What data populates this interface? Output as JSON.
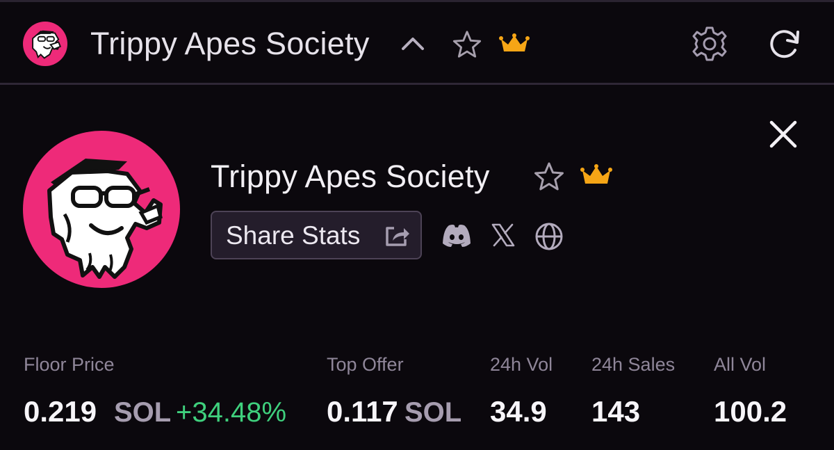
{
  "colors": {
    "background": "#0b080d",
    "accent_pink": "#ee2a79",
    "crown_gold": "#f5a516",
    "positive_green": "#3fd07d",
    "muted_text": "#8f8699"
  },
  "header": {
    "title": "Trippy Apes Society",
    "icons": [
      "collection-avatar",
      "chevron-up-icon",
      "star-icon",
      "crown-icon",
      "gear-icon",
      "refresh-icon"
    ]
  },
  "collection": {
    "name": "Trippy Apes Society",
    "share_label": "Share Stats",
    "icons": [
      "close-icon",
      "star-icon",
      "crown-icon",
      "share-icon",
      "discord-icon",
      "x-icon",
      "globe-icon"
    ]
  },
  "stats": {
    "floor_price": {
      "label": "Floor Price",
      "value": "0.219",
      "unit": "SOL",
      "change": "+34.48%"
    },
    "top_offer": {
      "label": "Top Offer",
      "value": "0.117",
      "unit": "SOL"
    },
    "vol_24h": {
      "label": "24h Vol",
      "value": "34.9"
    },
    "sales_24h": {
      "label": "24h Sales",
      "value": "143"
    },
    "all_vol": {
      "label": "All Vol",
      "value": "100.2"
    }
  }
}
